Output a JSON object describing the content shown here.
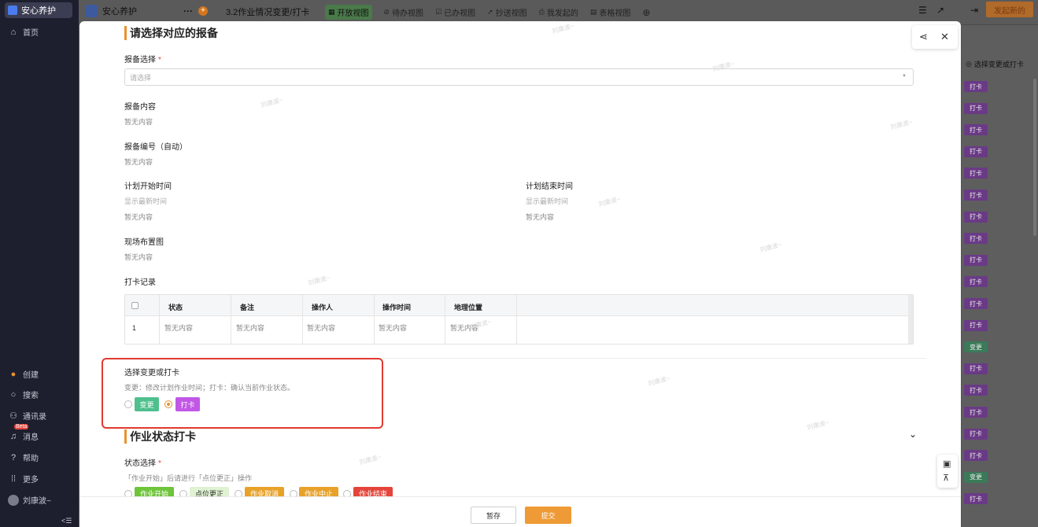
{
  "sidebar": {
    "workspace": "安心养护",
    "home": "首页",
    "create": "创建",
    "search": "搜索",
    "contacts": "通讯录",
    "messages": "消息",
    "messages_badge": "Beta",
    "help": "帮助",
    "more": "更多",
    "user": "刘康波~",
    "collapse": "<☰"
  },
  "topbar": {
    "app_name": "安心养护",
    "more": "···",
    "add": "+",
    "form_title": "3.2作业情况变更/打卡",
    "views": [
      {
        "label": "开放视图",
        "icon": "▦"
      },
      {
        "label": "待办视图",
        "icon": "⊘"
      },
      {
        "label": "已办视图",
        "icon": "☑"
      },
      {
        "label": "抄送视图",
        "icon": "➚"
      },
      {
        "label": "我发起的",
        "icon": "⎙"
      },
      {
        "label": "表格视图",
        "icon": "▤"
      }
    ],
    "add_view": "⊕",
    "launch_button": "发起新的"
  },
  "background_table": {
    "column_header": "选择变更或打卡",
    "chips": [
      "打卡",
      "打卡",
      "打卡",
      "打卡",
      "打卡",
      "打卡",
      "打卡",
      "打卡",
      "打卡",
      "打卡",
      "打卡",
      "打卡",
      "变更",
      "打卡",
      "打卡",
      "打卡",
      "打卡",
      "打卡",
      "变更",
      "打卡"
    ],
    "colors": {
      "打卡": "#6a3a86",
      "变更": "#3a7a58"
    }
  },
  "modal": {
    "section1_title": "请选择对应的报备",
    "report_select_label": "报备选择",
    "required_mark": "*",
    "report_select_placeholder": "请选择",
    "report_content_label": "报备内容",
    "empty": "暂无内容",
    "report_number_label": "报备编号（自动）",
    "plan_start_label": "计划开始时间",
    "plan_end_label": "计划结束时间",
    "show_latest": "显示最新时间",
    "layout_label": "现场布置图",
    "checkin_record_label": "打卡记录",
    "table": {
      "columns": [
        "状态",
        "备注",
        "操作人",
        "操作时间",
        "地理位置"
      ],
      "rows": [
        {
          "index": "1",
          "cells": [
            "暂无内容",
            "暂无内容",
            "暂无内容",
            "暂无内容",
            "暂无内容"
          ]
        }
      ]
    },
    "choice_label": "选择变更或打卡",
    "choice_hint": "变更：修改计划作业时间；打卡：确认当前作业状态。",
    "choice_options": [
      {
        "label": "变更",
        "selected": false,
        "color": "#4fc08d"
      },
      {
        "label": "打卡",
        "selected": true,
        "color": "#c257e6"
      }
    ],
    "section2_title": "作业状态打卡",
    "status_select_label": "状态选择",
    "status_hint": "「作业开始」后请进行「点位更正」操作",
    "status_options": [
      "作业开始",
      "点位更正",
      "作业取消",
      "作业中止",
      "作业结束"
    ],
    "save_button": "暂存",
    "submit_button": "提交",
    "watermark": "刘康波~"
  },
  "colors": {
    "accent": "#e8912d",
    "highlight_border": "#e03a2f",
    "submit": "#ee9a36"
  }
}
